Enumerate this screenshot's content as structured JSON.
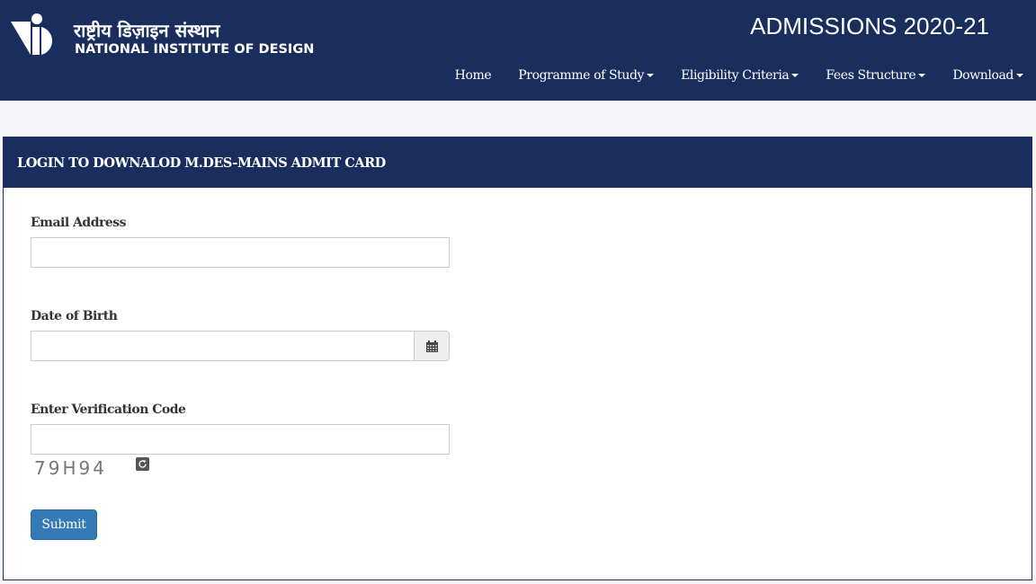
{
  "header": {
    "logo_hindi": "राष्ट्रीय डिज़ाइन संस्थान",
    "logo_english": "NATIONAL INSTITUTE OF DESIGN",
    "title": "ADMISSIONS 2020-21",
    "background_color": "#1a2e5e"
  },
  "nav": {
    "items": [
      {
        "label": "Home",
        "dropdown": false
      },
      {
        "label": "Programme of Study",
        "dropdown": true
      },
      {
        "label": "Eligibility Criteria",
        "dropdown": true
      },
      {
        "label": "Fees Structure",
        "dropdown": true
      },
      {
        "label": "Download",
        "dropdown": true
      }
    ]
  },
  "panel": {
    "title": "LOGIN TO DOWNALOD M.DES-MAINS ADMIT CARD"
  },
  "form": {
    "email_label": "Email Address",
    "email_value": "",
    "dob_label": "Date of Birth",
    "dob_value": "",
    "dob_icon": "calendar-icon",
    "verification_label": "Enter Verification Code",
    "verification_value": "",
    "captcha_text": "79H94",
    "refresh_icon": "refresh-icon",
    "submit_label": "Submit",
    "submit_color": "#337ab7"
  }
}
